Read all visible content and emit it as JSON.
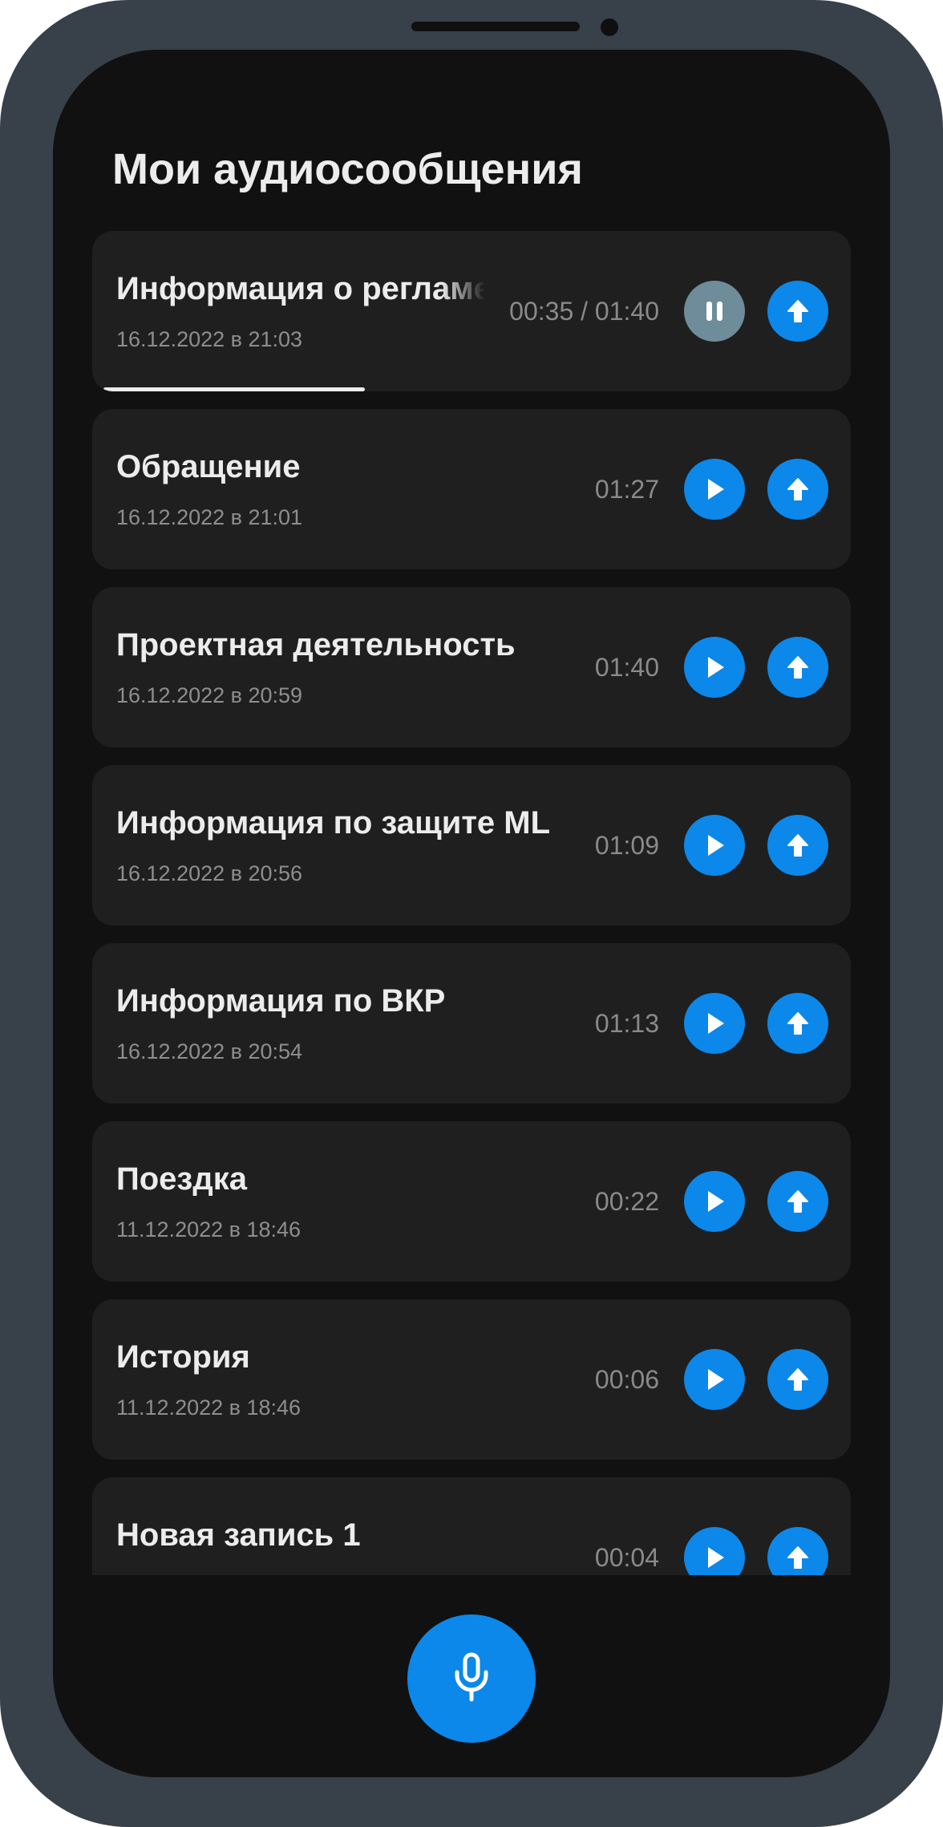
{
  "header": {
    "title": "Мои аудиосообщения"
  },
  "recordings": [
    {
      "title": "Информация о регламенте",
      "date": "16.12.2022 в 21:03",
      "time": "00:35 / 01:40",
      "playing": true,
      "progress": 0.35
    },
    {
      "title": "Обращение",
      "date": "16.12.2022 в 21:01",
      "time": "01:27",
      "playing": false
    },
    {
      "title": "Проектная деятельность",
      "date": "16.12.2022 в 20:59",
      "time": "01:40",
      "playing": false
    },
    {
      "title": "Информация по защите ML",
      "date": "16.12.2022 в 20:56",
      "time": "01:09",
      "playing": false
    },
    {
      "title": "Информация по ВКР",
      "date": "16.12.2022 в 20:54",
      "time": "01:13",
      "playing": false
    },
    {
      "title": "Поездка",
      "date": "11.12.2022 в 18:46",
      "time": "00:22",
      "playing": false
    },
    {
      "title": "История",
      "date": "11.12.2022 в 18:46",
      "time": "00:06",
      "playing": false
    },
    {
      "title": "Новая запись 1",
      "date": "",
      "time": "00:04",
      "playing": false
    }
  ],
  "icons": {
    "play": "play-icon",
    "pause": "pause-icon",
    "upload": "arrow-up-icon",
    "mic": "microphone-icon"
  },
  "colors": {
    "accent": "#0b88ea",
    "pause_button": "#6f8c9a",
    "background": "#111111",
    "card": "#1f1f1f",
    "frame": "#384049"
  }
}
